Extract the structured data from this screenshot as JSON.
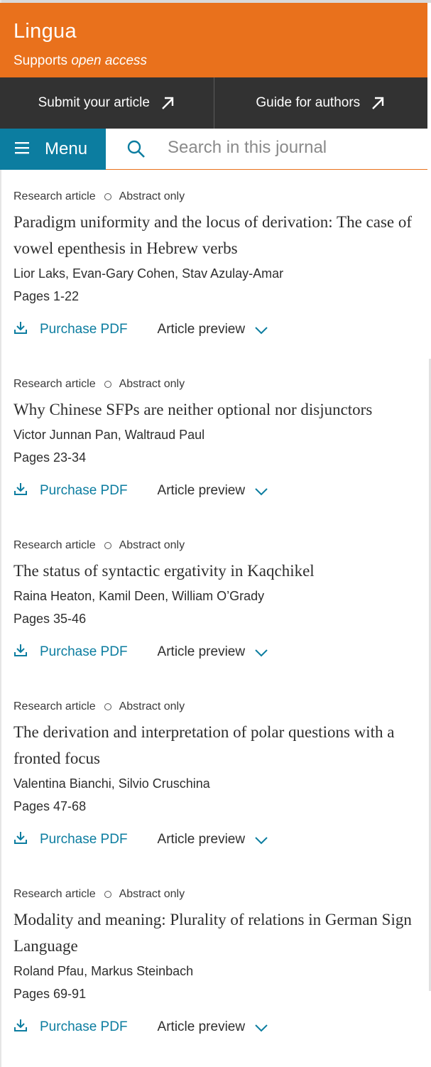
{
  "journal": {
    "title": "Lingua",
    "supports_prefix": "Supports",
    "supports_italic": "open access"
  },
  "actions": {
    "submit_label": "Submit your article",
    "guide_label": "Guide for authors"
  },
  "nav": {
    "menu_label": "Menu",
    "search_placeholder": "Search in this journal"
  },
  "articles": [
    {
      "type": "Research article",
      "access": "Abstract only",
      "title": "Paradigm uniformity and the locus of derivation: The case of vowel epenthesis in Hebrew verbs",
      "authors": "Lior Laks, Evan-Gary Cohen, Stav Azulay-Amar",
      "pages": "Pages 1-22",
      "purchase_label": "Purchase PDF",
      "preview_label": "Article preview"
    },
    {
      "type": "Research article",
      "access": "Abstract only",
      "title": "Why Chinese SFPs are neither optional nor disjunctors",
      "authors": "Victor Junnan Pan, Waltraud Paul",
      "pages": "Pages 23-34",
      "purchase_label": "Purchase PDF",
      "preview_label": "Article preview"
    },
    {
      "type": "Research article",
      "access": "Abstract only",
      "title": "The status of syntactic ergativity in Kaqchikel",
      "authors": "Raina Heaton, Kamil Deen, William O’Grady",
      "pages": "Pages 35-46",
      "purchase_label": "Purchase PDF",
      "preview_label": "Article preview"
    },
    {
      "type": "Research article",
      "access": "Abstract only",
      "title": "The derivation and interpretation of polar questions with a fronted focus",
      "authors": "Valentina Bianchi, Silvio Cruschina",
      "pages": "Pages 47-68",
      "purchase_label": "Purchase PDF",
      "preview_label": "Article preview"
    },
    {
      "type": "Research article",
      "access": "Abstract only",
      "title": "Modality and meaning: Plurality of relations in German Sign Language",
      "authors": "Roland Pfau, Markus Steinbach",
      "pages": "Pages 69-91",
      "purchase_label": "Purchase PDF",
      "preview_label": "Article preview"
    }
  ],
  "colors": {
    "brand_orange": "#e9711c",
    "link_blue": "#0c7da0",
    "dark_bar": "#323232"
  }
}
